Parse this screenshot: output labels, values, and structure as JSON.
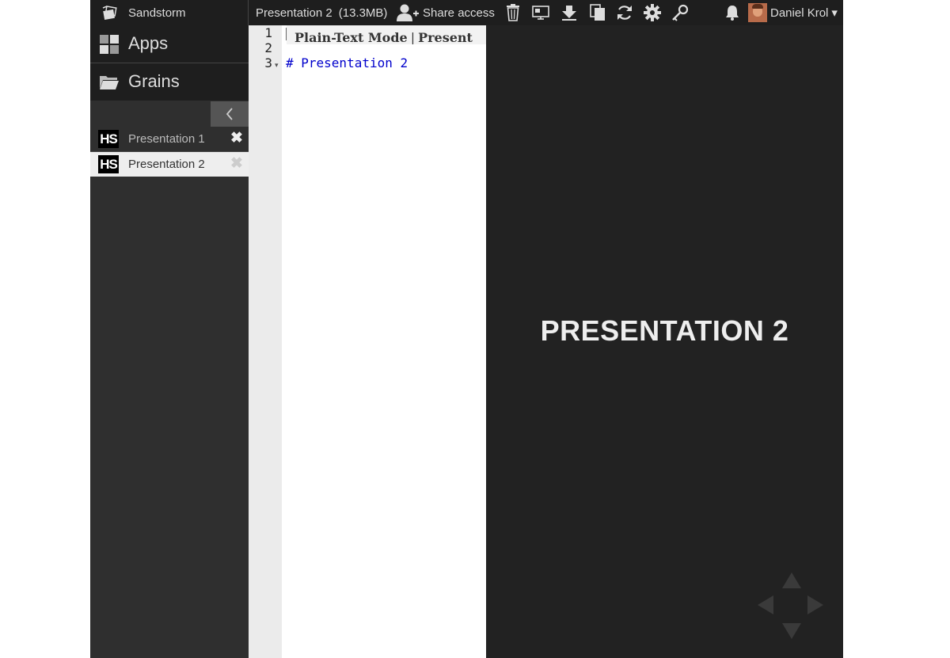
{
  "topbar": {
    "brand": "Sandstorm",
    "grain_title": "Presentation 2",
    "grain_size": "(13.3MB)",
    "share_label": "Share access",
    "user_name": "Daniel Krol",
    "user_caret": "▾",
    "icons": [
      "trash-icon",
      "present-icon",
      "download-icon",
      "copy-icon",
      "restart-icon",
      "settings-icon",
      "key-icon",
      "bell-icon"
    ]
  },
  "sidebar": {
    "nav": [
      {
        "label": "Apps",
        "icon": "apps-grid-icon"
      },
      {
        "label": "Grains",
        "icon": "folder-icon"
      }
    ],
    "grains": [
      {
        "badge": "HS",
        "name": "Presentation 1",
        "active": false
      },
      {
        "badge": "HS",
        "name": "Presentation 2",
        "active": true
      }
    ],
    "close_glyph": "✖",
    "collapse_glyph": "‹"
  },
  "editor": {
    "line_numbers": [
      "1",
      "2",
      "3"
    ],
    "mode_label": "Plain-Text Mode",
    "separator": "|",
    "present_label": "Present",
    "code_line": "# Presentation 2"
  },
  "preview": {
    "slide_title": "PRESENTATION 2"
  },
  "colors": {
    "topbar_bg": "#1e1e1e",
    "sidebar_bg": "#2f2f2f",
    "preview_bg": "#222222",
    "code_color": "#0000cc"
  }
}
